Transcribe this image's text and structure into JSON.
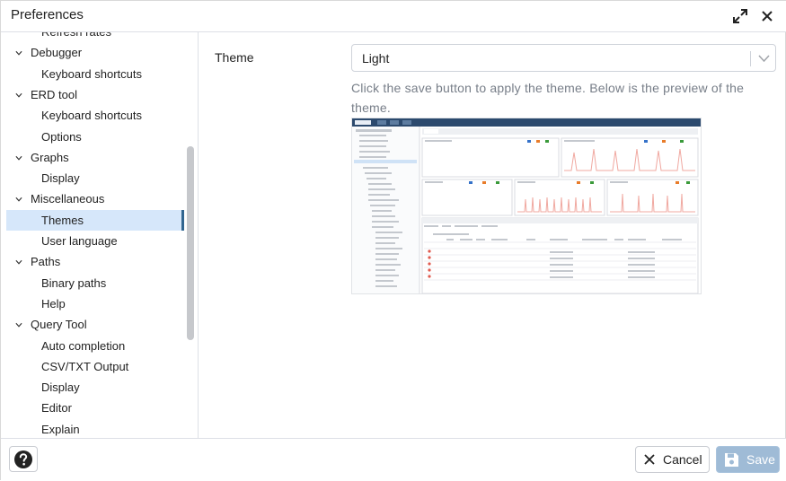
{
  "window": {
    "title": "Preferences"
  },
  "tree": {
    "items": [
      {
        "label": "Refresh rates",
        "level": "child"
      },
      {
        "label": "Debugger",
        "level": "group"
      },
      {
        "label": "Keyboard shortcuts",
        "level": "child"
      },
      {
        "label": "ERD tool",
        "level": "group"
      },
      {
        "label": "Keyboard shortcuts",
        "level": "child"
      },
      {
        "label": "Options",
        "level": "child"
      },
      {
        "label": "Graphs",
        "level": "group"
      },
      {
        "label": "Display",
        "level": "child"
      },
      {
        "label": "Miscellaneous",
        "level": "group"
      },
      {
        "label": "Themes",
        "level": "child",
        "selected": true
      },
      {
        "label": "User language",
        "level": "child"
      },
      {
        "label": "Paths",
        "level": "group"
      },
      {
        "label": "Binary paths",
        "level": "child"
      },
      {
        "label": "Help",
        "level": "child"
      },
      {
        "label": "Query Tool",
        "level": "group"
      },
      {
        "label": "Auto completion",
        "level": "child"
      },
      {
        "label": "CSV/TXT Output",
        "level": "child"
      },
      {
        "label": "Display",
        "level": "child"
      },
      {
        "label": "Editor",
        "level": "child"
      },
      {
        "label": "Explain",
        "level": "child"
      }
    ]
  },
  "content": {
    "theme_label": "Theme",
    "theme_value": "Light",
    "help_text": "Click the save button to apply the theme. Below is the preview of the theme."
  },
  "footer": {
    "cancel_label": "Cancel",
    "save_label": "Save"
  },
  "colors": {
    "selected_bg": "#d6e7fa",
    "selected_bar": "#326690",
    "save_bg": "#9fbbd6",
    "preview_header": "#2c4a6e"
  },
  "icons": {
    "expand": "expand-icon",
    "close": "close-icon",
    "chevron": "chevron-down-icon",
    "help": "question-circle-icon",
    "cancel": "x-icon",
    "save": "floppy-disk-icon"
  }
}
